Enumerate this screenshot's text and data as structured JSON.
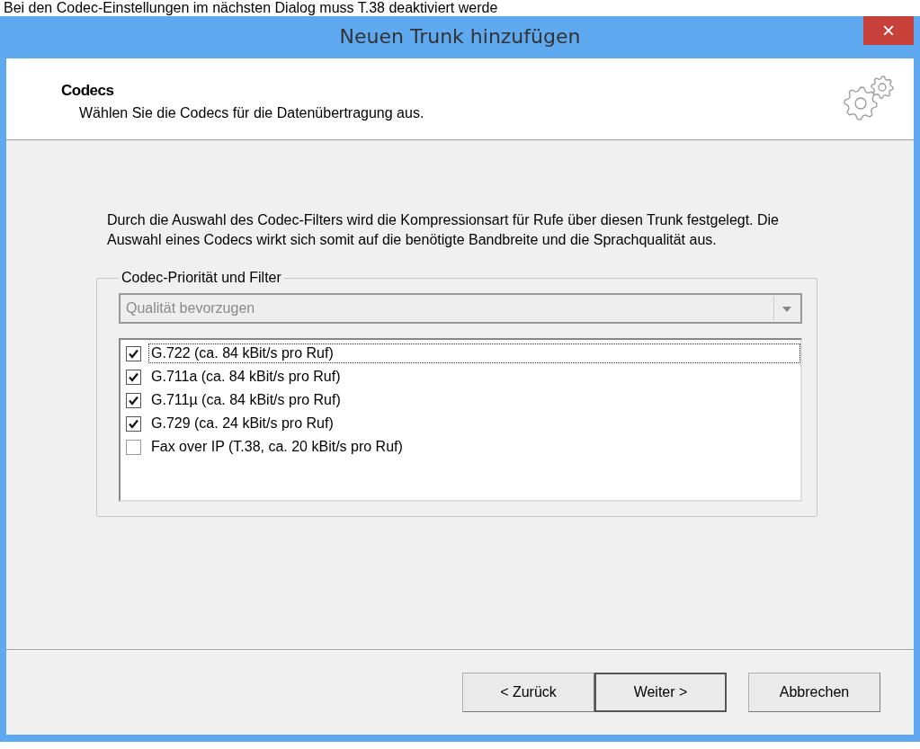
{
  "caption": "Bei den Codec-Einstellungen im nächsten Dialog muss T.38 deaktiviert werde",
  "window": {
    "title": "Neuen Trunk hinzufügen",
    "close": "×"
  },
  "header": {
    "title": "Codecs",
    "subtitle": "Wählen Sie die Codecs für die Datenübertragung aus."
  },
  "description": "Durch die Auswahl des Codec-Filters wird die Kompressionsart für Rufe über diesen Trunk festgelegt. Die Auswahl eines Codecs wirkt sich somit auf die benötigte Bandbreite und die Sprachqualität aus.",
  "group": {
    "title": "Codec-Priorität und Filter",
    "dropdown": {
      "value": "Qualität bevorzugen",
      "disabled": true
    },
    "codecs": [
      {
        "label": "G.722 (ca. 84 kBit/s pro Ruf)",
        "checked": true,
        "focused": true
      },
      {
        "label": "G.711a (ca. 84 kBit/s pro Ruf)",
        "checked": true,
        "focused": false
      },
      {
        "label": "G.711µ (ca. 84 kBit/s pro Ruf)",
        "checked": true,
        "focused": false
      },
      {
        "label": "G.729 (ca. 24 kBit/s pro Ruf)",
        "checked": true,
        "focused": false
      },
      {
        "label": "Fax over IP (T.38, ca. 20 kBit/s pro Ruf)",
        "checked": false,
        "focused": false
      }
    ]
  },
  "buttons": [
    {
      "label": "< Zurück",
      "default": false
    },
    {
      "label": "Weiter >",
      "default": true
    },
    {
      "label": "Abbrechen",
      "default": false
    }
  ]
}
